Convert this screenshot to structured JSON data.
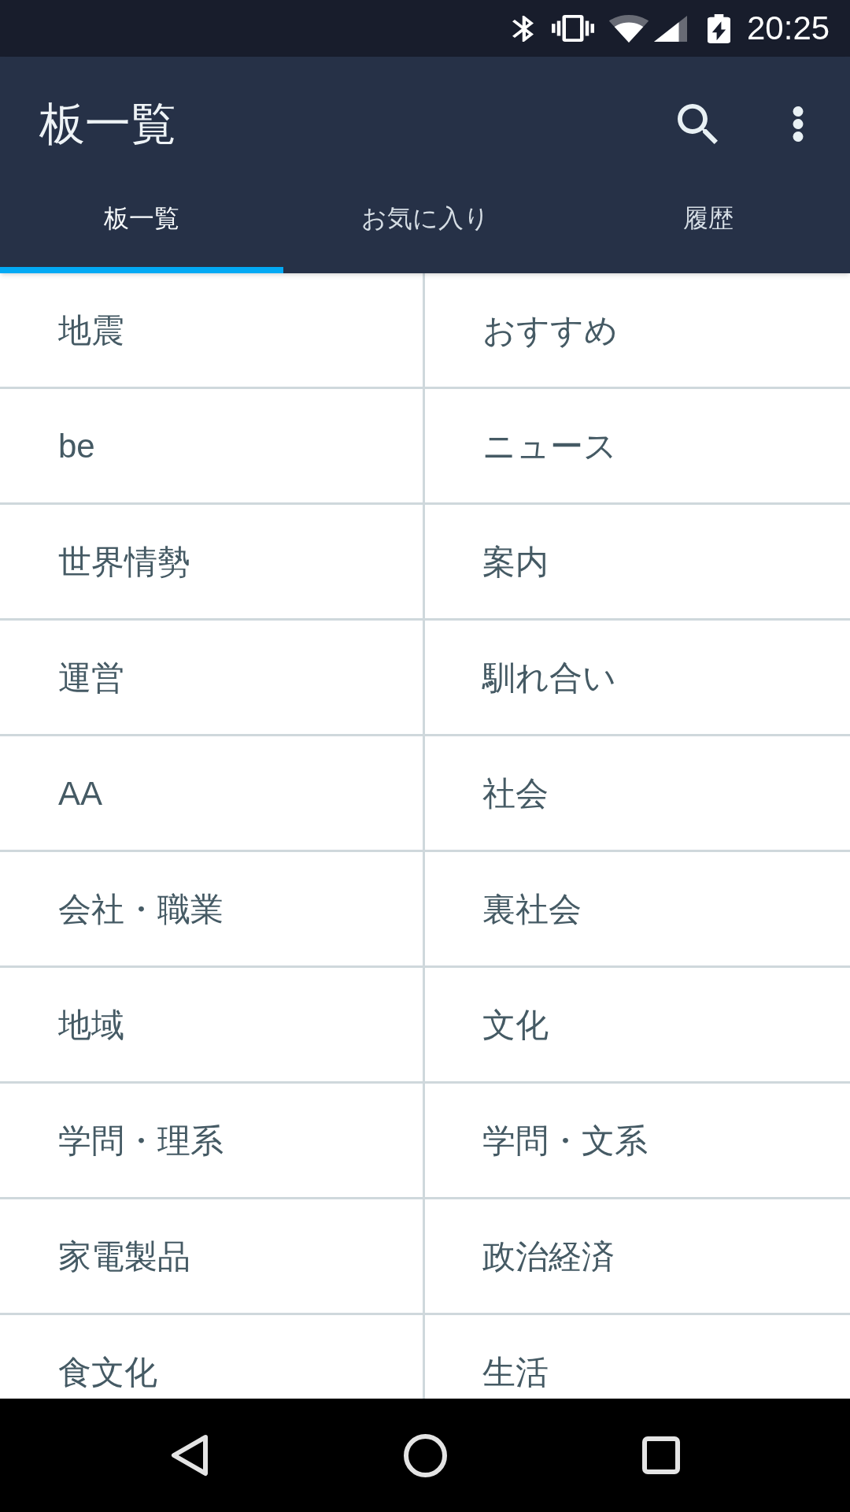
{
  "status_bar": {
    "time": "20:25"
  },
  "app_bar": {
    "title": "板一覧"
  },
  "tabs": [
    {
      "label": "板一覧",
      "selected": true
    },
    {
      "label": "お気に入り",
      "selected": false
    },
    {
      "label": "履歴",
      "selected": false
    }
  ],
  "boards": [
    "地震",
    "おすすめ",
    "be",
    "ニュース",
    "世界情勢",
    "案内",
    "運営",
    "馴れ合い",
    "AA",
    "社会",
    "会社・職業",
    "裏社会",
    "地域",
    "文化",
    "学問・理系",
    "学問・文系",
    "家電製品",
    "政治経済",
    "食文化",
    "生活"
  ]
}
